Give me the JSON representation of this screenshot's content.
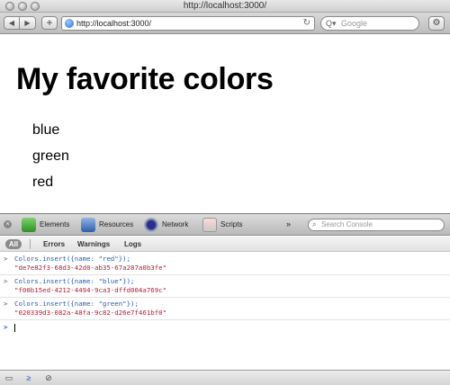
{
  "window": {
    "title": "http://localhost:3000/"
  },
  "toolbar": {
    "back_icon": "◀",
    "forward_icon": "▶",
    "add_icon": "+",
    "url": "http://localhost:3000/",
    "reload_icon": "↻",
    "search_placeholder": "Google",
    "search_icon": "Q▾",
    "settings_icon": "⚙"
  },
  "page": {
    "title": "My favorite colors",
    "colors": [
      "blue",
      "green",
      "red"
    ]
  },
  "inspector": {
    "close_icon": "×",
    "tabs": [
      {
        "label": "Elements",
        "icon": "elements-icon"
      },
      {
        "label": "Resources",
        "icon": "resources-icon"
      },
      {
        "label": "Network",
        "icon": "network-icon"
      },
      {
        "label": "Scripts",
        "icon": "scripts-icon"
      }
    ],
    "more_icon": "»",
    "console_search_placeholder": "Search Console",
    "scopes": {
      "all": "All",
      "errors": "Errors",
      "warnings": "Warnings",
      "logs": "Logs"
    },
    "entries": [
      {
        "command": "Colors.insert({name: \"red\"});",
        "result": "\"de7e82f3-68d3-42d0-ab35-67a287a0b3fe\""
      },
      {
        "command": "Colors.insert({name: \"blue\"});",
        "result": "\"f00b15ed-4212-4494-9ca3-dffd004a769c\""
      },
      {
        "command": "Colors.insert({name: \"green\"});",
        "result": "\"020339d3-082a-48fa-9c82-d26e7f461bf0\""
      }
    ],
    "prompt_symbol": ">",
    "status_icons": {
      "dock": "▭",
      "console": "≥",
      "clear": "⊘"
    }
  }
}
